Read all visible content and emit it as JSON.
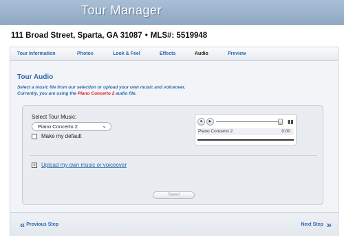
{
  "app": {
    "title": "Tour Manager"
  },
  "listing": {
    "address": "111 Broad Street, Sparta, GA 31087",
    "separator": "•",
    "mls": "MLS#: 5519948"
  },
  "tabs": [
    {
      "label": "Tour Information"
    },
    {
      "label": "Photos"
    },
    {
      "label": "Look & Feel"
    },
    {
      "label": "Effects"
    },
    {
      "label": "Audio"
    },
    {
      "label": "Preview"
    }
  ],
  "active_tab": "Audio",
  "audio": {
    "title": "Tour Audio",
    "desc_line1": "Select a music file from our selection or upload your own music and voiceover.",
    "desc_line2_prefix": "Currently, you are using the ",
    "desc_current": "Piano Concerto 2",
    "desc_line2_suffix": " audio file.",
    "select_label": "Select Tour Music:",
    "select_value": "Piano Concerto 2",
    "default_checkbox_label": "Make my default",
    "default_checked": false,
    "player": {
      "track": "Piano Concerto 2",
      "time": "0:00"
    },
    "upload_toggle": "+",
    "upload_link": "Upload my own music or voiceover",
    "saved_button": "Saved"
  },
  "nav": {
    "prev_arrow": "«",
    "prev_label": "Previous Step",
    "next_label": "Next Step",
    "next_arrow": "»"
  },
  "colors": {
    "link": "#2b67b0",
    "highlight": "#d51c1c",
    "header": "#9bb3cc"
  }
}
